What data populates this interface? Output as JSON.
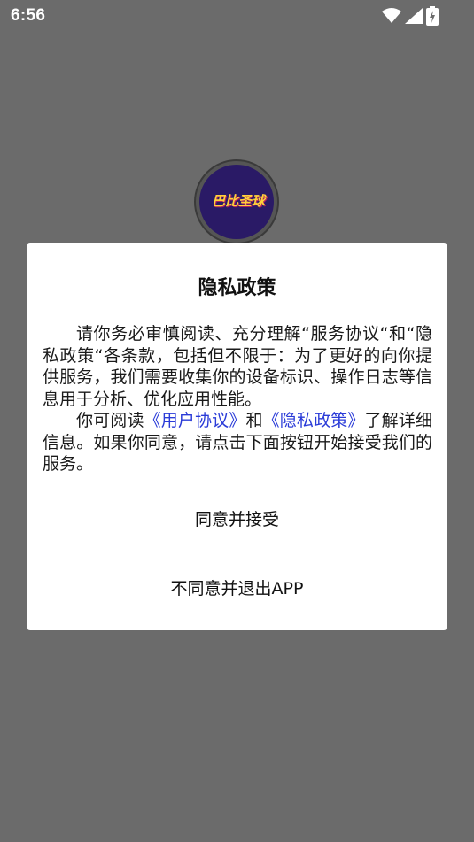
{
  "status_bar": {
    "time": "6:56",
    "icons": [
      "wifi-icon",
      "signal-icon",
      "battery-charging-icon"
    ]
  },
  "logo": {
    "text": "巴比圣球"
  },
  "dialog": {
    "title": "隐私政策",
    "para1": "请你务必审慎阅读、充分理解“服务协议“和“隐私政策“各条款，包括但不限于：为了更好的向你提供服务，我们需要收集你的设备标识、操作日志等信息用于分析、优化应用性能。",
    "para2_prefix": "你可阅读",
    "link_user_agreement": "《用户协议》",
    "para2_and": "和",
    "link_privacy_policy": "《隐私政策》",
    "para2_suffix": "了解详细信息。如果你同意，请点击下面按钮开始接受我们的服务。",
    "agree_label": "同意并接受",
    "disagree_label": "不同意并退出APP"
  },
  "colors": {
    "overlay": "#6b6b6b",
    "link": "#2a3bd8",
    "logo_bg": "#2a1a66"
  }
}
